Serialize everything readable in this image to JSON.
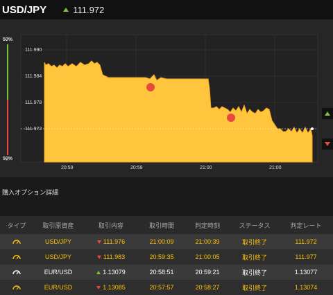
{
  "header": {
    "pair": "USD/JPY",
    "price": "111.972"
  },
  "chart": {
    "y_ticks": [
      "111.990",
      "111.984",
      "111.978",
      "111.972"
    ],
    "x_ticks": [
      "20:59",
      "20:59",
      "21:00",
      "21:00"
    ],
    "top_pct": "50%",
    "bottom_pct": "50%",
    "close_label": "×",
    "fill_color": "#ffc53d",
    "line_color": "#f5a623"
  },
  "section": {
    "title": "購入オプション詳細"
  },
  "table": {
    "headers": [
      "タイプ",
      "取引原資産",
      "取引内容",
      "取引時間",
      "判定時刻",
      "ステータス",
      "判定レート"
    ],
    "rows": [
      {
        "asset": "USD/JPY",
        "direction": "down",
        "rate": "111.976",
        "time": "21:00:09",
        "judge": "21:00:39",
        "status": "取引終了",
        "result": "111.972"
      },
      {
        "asset": "USD/JPY",
        "direction": "down",
        "rate": "111.983",
        "time": "20:59:35",
        "judge": "21:00:05",
        "status": "取引終了",
        "result": "111.977"
      },
      {
        "asset": "EUR/USD",
        "direction": "up",
        "rate": "1.13079",
        "time": "20:58:51",
        "judge": "20:59:21",
        "status": "取引終了",
        "result": "1.13077"
      },
      {
        "asset": "EUR/USD",
        "direction": "down",
        "rate": "1.13085",
        "time": "20:57:57",
        "judge": "20:58:27",
        "status": "取引終了",
        "result": "1.13074"
      }
    ]
  }
}
